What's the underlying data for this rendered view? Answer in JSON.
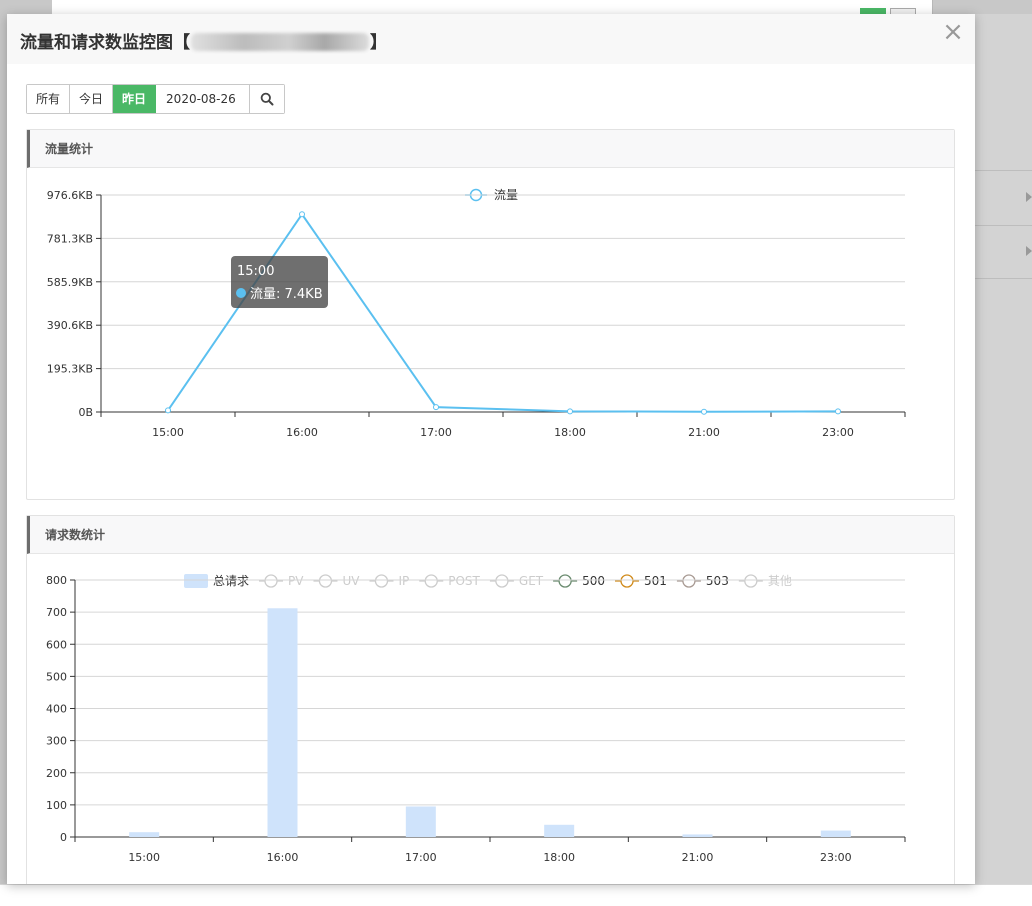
{
  "modal": {
    "title": "流量和请求数监控图【",
    "title_end": "】",
    "close_label": "×"
  },
  "toolbar": {
    "all": "所有",
    "today": "今日",
    "yesterday": "昨日",
    "date_value": "2020-08-26",
    "active": "yesterday",
    "search_icon": "search-icon"
  },
  "traffic_panel": {
    "title": "流量统计",
    "legend": "流量",
    "tooltip": {
      "time": "15:00",
      "label": "流量: 7.4KB"
    }
  },
  "request_panel": {
    "title": "请求数统计",
    "legend": [
      {
        "name": "总请求",
        "kind": "bar",
        "color": "#cfe3fb",
        "active": true
      },
      {
        "name": "PV",
        "kind": "line",
        "color": "#cccccc",
        "active": false
      },
      {
        "name": "UV",
        "kind": "line",
        "color": "#cccccc",
        "active": false
      },
      {
        "name": "IP",
        "kind": "line",
        "color": "#cccccc",
        "active": false
      },
      {
        "name": "POST",
        "kind": "line",
        "color": "#cccccc",
        "active": false
      },
      {
        "name": "GET",
        "kind": "line",
        "color": "#cccccc",
        "active": false
      },
      {
        "name": "500",
        "kind": "line",
        "color": "#6a8b6f",
        "active": true
      },
      {
        "name": "501",
        "kind": "line",
        "color": "#d08a1a",
        "active": true
      },
      {
        "name": "503",
        "kind": "line",
        "color": "#a89a93",
        "active": true
      },
      {
        "name": "其他",
        "kind": "line",
        "color": "#cccccc",
        "active": false
      }
    ]
  },
  "chart_data": [
    {
      "type": "line",
      "title": "流量统计",
      "categories": [
        "15:00",
        "16:00",
        "17:00",
        "18:00",
        "21:00",
        "23:00"
      ],
      "series": [
        {
          "name": "流量",
          "values_kb": [
            7.4,
            890,
            22,
            3,
            1,
            3
          ],
          "color": "#5bc0f0"
        }
      ],
      "y_ticks": [
        "0B",
        "195.3KB",
        "390.6KB",
        "585.9KB",
        "781.3KB",
        "976.6KB"
      ],
      "ylim_kb": [
        0,
        976.6
      ],
      "grid": true,
      "legend_position": "top-center"
    },
    {
      "type": "bar",
      "title": "请求数统计",
      "categories": [
        "15:00",
        "16:00",
        "17:00",
        "18:00",
        "21:00",
        "23:00"
      ],
      "series": [
        {
          "name": "总请求",
          "values": [
            15,
            712,
            95,
            38,
            8,
            20
          ],
          "color": "#cfe3fb"
        }
      ],
      "y_ticks": [
        "0",
        "100",
        "200",
        "300",
        "400",
        "500",
        "600",
        "700",
        "800"
      ],
      "ylim": [
        0,
        800
      ],
      "grid": true,
      "legend_position": "top-center"
    }
  ]
}
